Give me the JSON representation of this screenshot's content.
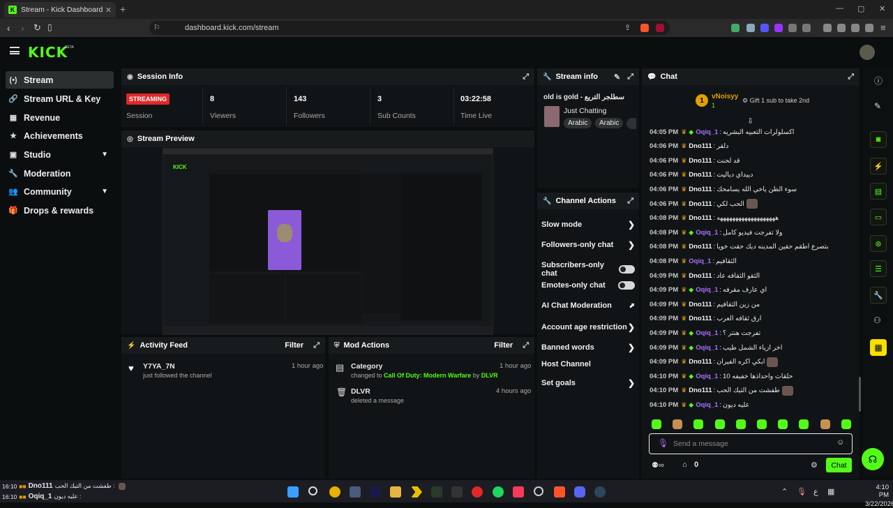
{
  "browser": {
    "tab_title": "Stream - Kick Dashboard",
    "tab_close": "✕",
    "new_tab": "+",
    "url": "dashboard.kick.com/stream",
    "win_min": "—",
    "win_max": "▢",
    "win_close": "✕"
  },
  "header": {
    "logo": "KICK",
    "beta": "BETA"
  },
  "sidebar": {
    "items": [
      {
        "label": "Stream",
        "icon": "(•)"
      },
      {
        "label": "Stream URL & Key",
        "icon": "🔗"
      },
      {
        "label": "Revenue",
        "icon": "▦"
      },
      {
        "label": "Achievements",
        "icon": "★"
      },
      {
        "label": "Studio",
        "icon": "▣"
      },
      {
        "label": "Moderation",
        "icon": "🔧"
      },
      {
        "label": "Community",
        "icon": "👥"
      },
      {
        "label": "Drops & rewards",
        "icon": "🎁"
      }
    ]
  },
  "session": {
    "title": "Session Info",
    "live_badge": "STREAMING",
    "session_label": "Session",
    "viewers": "8",
    "viewers_label": "Viewers",
    "followers": "143",
    "followers_label": "Followers",
    "subs": "3",
    "subs_label": "Sub Counts",
    "time": "03:22:58",
    "time_label": "Time Live"
  },
  "preview": {
    "title": "Stream Preview"
  },
  "stream_info": {
    "title": "Stream info",
    "stream_title": "old is gold - سطلجر التريع",
    "category": "Just Chatting",
    "tags": [
      "Arabic",
      "Arabic"
    ]
  },
  "channel_actions": {
    "title": "Channel Actions",
    "items": [
      "Slow mode",
      "Followers-only chat",
      "Subscribers-only chat",
      "Emotes-only chat",
      "AI Chat Moderation",
      "Account age restriction",
      "Banned words",
      "Host Channel",
      "Set goals"
    ]
  },
  "activity": {
    "title": "Activity Feed",
    "filter": "Filter",
    "user": "Y7YA_7N",
    "sub": "just followed the channel",
    "time": "1 hour ago"
  },
  "mod_actions": {
    "title": "Mod Actions",
    "filter": "Filter",
    "items": [
      {
        "head": "Category",
        "pre": "changed to ",
        "game": "Call Of Duty: Modern Warfare",
        "by": " by ",
        "mod": "DLVR",
        "time": "1 hour ago"
      },
      {
        "head": "DLVR",
        "sub": "deleted a message",
        "time": "4 hours ago"
      }
    ]
  },
  "chat": {
    "title": "Chat",
    "top_user": "vNoisyy",
    "top_rank": "1",
    "top_count": "1",
    "gift_text": "Gift 1 sub to take 2nd",
    "messages": [
      {
        "t": "04:05 PM",
        "u": "Oqiq_1",
        "c": "اكسلولرات التعبيه البشريه",
        "color": "#a970ff",
        "gem": true
      },
      {
        "t": "04:06 PM",
        "u": "Dno111",
        "c": "دلقر",
        "color": "#f0f0f0",
        "gem": false
      },
      {
        "t": "04:06 PM",
        "u": "Dno111",
        "c": "قد لحنت",
        "color": "#f0f0f0",
        "gem": false
      },
      {
        "t": "04:06 PM",
        "u": "Dno111",
        "c": "دييداي دياليت",
        "color": "#f0f0f0",
        "gem": false
      },
      {
        "t": "04:06 PM",
        "u": "Dno111",
        "c": "سوء الظن ياخي الله يسامحك",
        "color": "#f0f0f0",
        "gem": false
      },
      {
        "t": "04:06 PM",
        "u": "Dno111",
        "c": "الحب لكي",
        "color": "#f0f0f0",
        "gem": false,
        "emote": true
      },
      {
        "t": "04:08 PM",
        "u": "Dno111",
        "c": "هههههههههههههههههههه",
        "color": "#f0f0f0",
        "gem": false
      },
      {
        "t": "04:08 PM",
        "u": "Oqiq_1",
        "c": "ولا تفرجت فيديو كامل",
        "color": "#a970ff",
        "gem": true
      },
      {
        "t": "04:08 PM",
        "u": "Dno111",
        "c": "بتصرع اطقم حقين المدينه ديك حقت خويا",
        "color": "#f0f0f0",
        "gem": false
      },
      {
        "t": "04:08 PM",
        "u": "Oqiq_1",
        "c": "الثقافيم",
        "color": "#a970ff",
        "gem": false
      },
      {
        "t": "04:09 PM",
        "u": "Dno111",
        "c": "الثقو الثقافه عاد",
        "color": "#f0f0f0",
        "gem": false
      },
      {
        "t": "04:09 PM",
        "u": "Oqiq_1",
        "c": "اي عارف مقرفه",
        "color": "#a970ff",
        "gem": true
      },
      {
        "t": "04:09 PM",
        "u": "Dno111",
        "c": "من زين الثقافيم",
        "color": "#f0f0f0",
        "gem": false
      },
      {
        "t": "04:09 PM",
        "u": "Dno111",
        "c": "ارق ثقافه العرب",
        "color": "#f0f0f0",
        "gem": false
      },
      {
        "t": "04:09 PM",
        "u": "Oqiq_1",
        "c": "تفرجت هنتر ؟",
        "color": "#a970ff",
        "gem": true
      },
      {
        "t": "04:09 PM",
        "u": "Oqiq_1",
        "c": "اخر ازياء الشمل طيب",
        "color": "#a970ff",
        "gem": true
      },
      {
        "t": "04:09 PM",
        "u": "Dno111",
        "c": "ابكي اكره الفيران",
        "color": "#f0f0f0",
        "gem": false,
        "emote": true
      },
      {
        "t": "04:10 PM",
        "u": "Oqiq_1",
        "c": "حلقات واحداذها خفيفه 10",
        "color": "#a970ff",
        "gem": true
      },
      {
        "t": "04:10 PM",
        "u": "Dno111",
        "c": "طفشت من التيك الحب",
        "color": "#f0f0f0",
        "gem": false,
        "emote": true
      },
      {
        "t": "04:10 PM",
        "u": "Oqiq_1",
        "c": "عليه ديون",
        "color": "#a970ff",
        "gem": true
      }
    ],
    "input_placeholder": "Send a message",
    "points": "0",
    "send_label": "Chat"
  },
  "taskbar": {
    "time": "4:10 PM",
    "date": "3/22/2026",
    "notif1_time": "16:10",
    "notif1_user": "Dno111",
    "notif1_msg": "طفشت من التيك الحب :",
    "notif2_time": "16:10",
    "notif2_user": "Oqiq_1",
    "notif2_msg": "عليه ديون :"
  },
  "colors": {
    "accent": "#53fc18",
    "live": "#e02828",
    "purple": "#a970ff"
  }
}
